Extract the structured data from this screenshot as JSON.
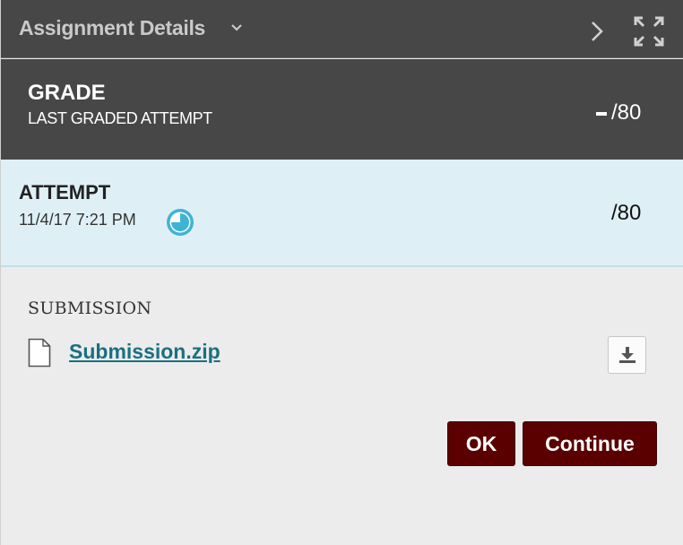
{
  "header": {
    "title": "Assignment Details"
  },
  "grade": {
    "title": "GRADE",
    "subtitle": "LAST GRADED ATTEMPT",
    "score": "/80"
  },
  "attempt": {
    "title": "ATTEMPT",
    "date": "11/4/17 7:21 PM",
    "score": "/80",
    "status_icon": "in-progress-clock-icon",
    "status_color": "#3fb3d6"
  },
  "submission": {
    "label": "SUBMISSION",
    "file_name": "Submission.zip"
  },
  "actions": {
    "ok_label": "OK",
    "continue_label": "Continue"
  },
  "colors": {
    "header_bg": "#474747",
    "attempt_bg": "#def0f5",
    "link": "#1b6f82",
    "button_bg": "#5a0000"
  }
}
